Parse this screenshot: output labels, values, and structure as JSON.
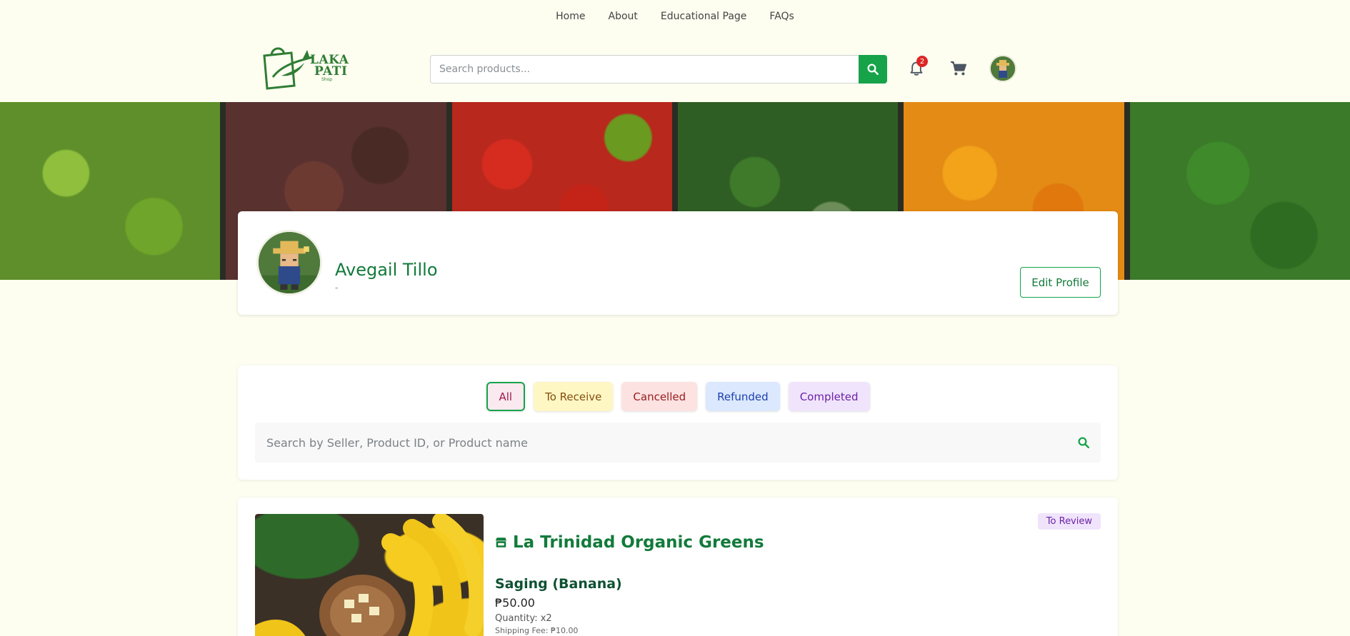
{
  "nav": {
    "links": [
      "Home",
      "About",
      "Educational Page",
      "FAQs"
    ]
  },
  "header": {
    "logo": {
      "line1": "LAKA",
      "line2": "PATI",
      "sub": "Shop"
    },
    "search_placeholder": "Search products...",
    "notification_count": "2",
    "icons": [
      "search-icon",
      "bell-icon",
      "cart-icon",
      "avatar"
    ]
  },
  "profile": {
    "name": "Avegail Tillo",
    "subtitle": "-",
    "edit_label": "Edit Profile"
  },
  "filters": {
    "tabs": [
      "All",
      "To Receive",
      "Cancelled",
      "Refunded",
      "Completed"
    ],
    "active": "All",
    "search_placeholder": "Search by Seller, Product ID, or Product name"
  },
  "order": {
    "store": "La Trinidad Organic Greens",
    "status": "To Review",
    "product": "Saging (Banana)",
    "price": "₱50.00",
    "quantity": "Quantity: x2",
    "shipping": "Shipping Fee: ₱10.00"
  },
  "colors": {
    "brand_green": "#16a34a",
    "text_green": "#127a3b",
    "page_bg": "#fdfdf0",
    "badge_red": "#dc2626"
  }
}
